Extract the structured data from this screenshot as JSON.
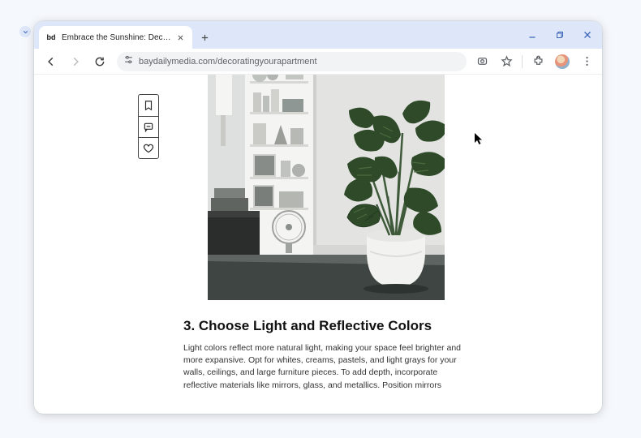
{
  "browser": {
    "tab_title": "Embrace the Sunshine: Dec…",
    "favicon_text": "bd",
    "url": "baydailymedia.com/decoratingyourapartment"
  },
  "side_rail": {
    "items": [
      {
        "name": "bookmark-icon"
      },
      {
        "name": "comment-icon"
      },
      {
        "name": "heart-icon"
      }
    ]
  },
  "article": {
    "heading": "3. Choose Light and Reflective Colors",
    "body": "Light colors reflect more natural light, making your space feel brighter and more expansive. Opt for whites, creams, pastels, and light grays for your walls, ceilings, and large furniture pieces. To add depth, incorporate reflective materials like mirrors, glass, and metallics. Position mirrors"
  }
}
